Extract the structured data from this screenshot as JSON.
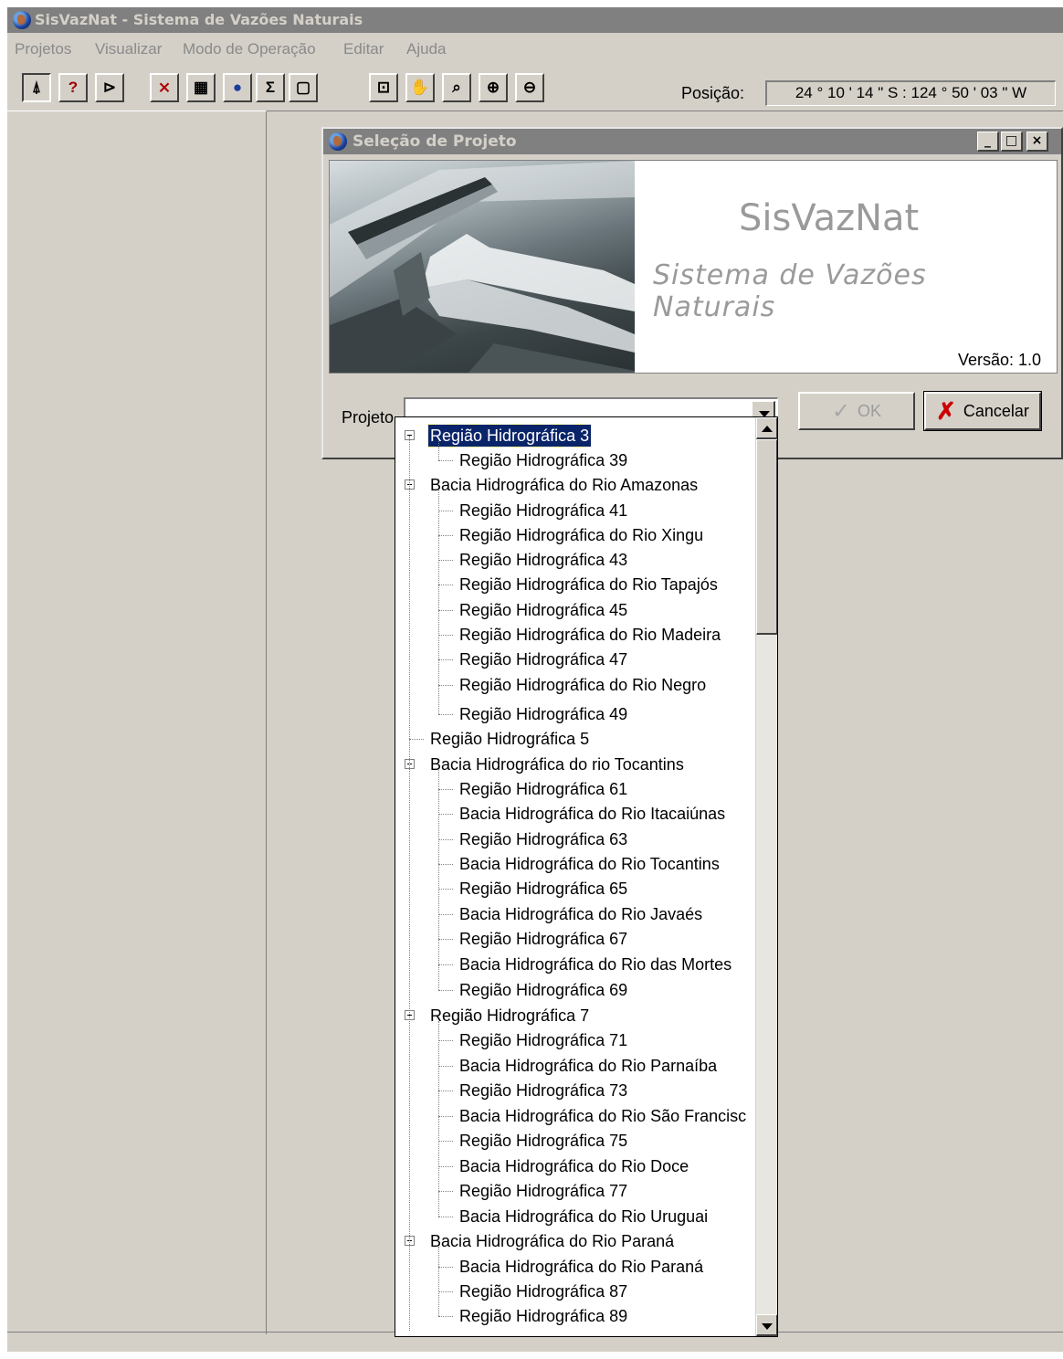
{
  "app": {
    "title": "SisVazNat - Sistema de Vazões Naturais"
  },
  "menu": [
    "Projetos",
    "Visualizar",
    "Modo de Operação",
    "Editar",
    "Ajuda"
  ],
  "toolbar": {
    "buttons": [
      {
        "name": "pointer-tool-icon",
        "glyph": "⍋"
      },
      {
        "name": "query-tool-icon",
        "glyph": "?"
      },
      {
        "name": "select-tool-icon",
        "glyph": "⊳"
      },
      {
        "name": "chart-icon",
        "glyph": "⨯"
      },
      {
        "name": "table-icon",
        "glyph": "▦"
      },
      {
        "name": "globe-icon",
        "glyph": "●"
      },
      {
        "name": "sum-icon",
        "glyph": "Σ"
      },
      {
        "name": "new-document-icon",
        "glyph": "▢"
      },
      {
        "name": "zoom-extent-icon",
        "glyph": "⊡"
      },
      {
        "name": "pan-hand-icon",
        "glyph": "✋"
      },
      {
        "name": "zoom-window-icon",
        "glyph": "⌕"
      },
      {
        "name": "zoom-in-icon",
        "glyph": "⊕"
      },
      {
        "name": "zoom-out-icon",
        "glyph": "⊖"
      }
    ],
    "position_label": "Posição:",
    "position_value": "24 ° 10 ' 14 \" S : 124 ° 50 ' 03 \" W"
  },
  "dialog": {
    "title": "Seleção de Projeto",
    "window_buttons": [
      "_",
      "□",
      "×"
    ],
    "brand": "SisVazNat",
    "brand_subtitle": "Sistema de Vazões Naturais",
    "version": "Versão: 1.0",
    "project_label": "Projeto",
    "project_value": "",
    "ok_label": "OK",
    "cancel_label": "Cancelar"
  },
  "tree": [
    {
      "label": "Região Hidrográfica 3",
      "level": 0,
      "expanded": true,
      "selected": true
    },
    {
      "label": "Região Hidrográfica 39",
      "level": 1
    },
    {
      "label": "Bacia Hidrográfica do Rio Amazonas",
      "level": 0,
      "expanded": true
    },
    {
      "label": "Região Hidrográfica 41",
      "level": 1
    },
    {
      "label": "Região Hidrográfica do Rio Xingu",
      "level": 1
    },
    {
      "label": "Região Hidrográfica 43",
      "level": 1
    },
    {
      "label": "Região Hidrográfica do Rio Tapajós",
      "level": 1
    },
    {
      "label": "Região Hidrográfica 45",
      "level": 1
    },
    {
      "label": "Região Hidrográfica do Rio Madeira",
      "level": 1
    },
    {
      "label": "Região Hidrográfica 47",
      "level": 1
    },
    {
      "label": "Região Hidrográfica do Rio Negro",
      "level": 1
    },
    {
      "label": "Região Hidrográfica 49",
      "level": 1
    },
    {
      "label": "Região Hidrográfica 5",
      "level": 0
    },
    {
      "label": "Bacia Hidrográfica do rio Tocantins",
      "level": 0,
      "expanded": true
    },
    {
      "label": "Região Hidrográfica 61",
      "level": 1
    },
    {
      "label": "Bacia Hidrográfica do Rio Itacaiúnas",
      "level": 1
    },
    {
      "label": "Região Hidrográfica 63",
      "level": 1
    },
    {
      "label": "Bacia Hidrográfica do Rio Tocantins",
      "level": 1
    },
    {
      "label": "Região Hidrográfica 65",
      "level": 1
    },
    {
      "label": "Bacia Hidrográfica do Rio Javaés",
      "level": 1
    },
    {
      "label": "Região Hidrográfica 67",
      "level": 1
    },
    {
      "label": "Bacia Hidrográfica do Rio das Mortes",
      "level": 1
    },
    {
      "label": "Região Hidrográfica 69",
      "level": 1
    },
    {
      "label": "Região Hidrográfica 7",
      "level": 0,
      "expanded": true
    },
    {
      "label": "Região Hidrográfica 71",
      "level": 1
    },
    {
      "label": "Bacia Hidrográfica do Rio Parnaíba",
      "level": 1
    },
    {
      "label": "Região Hidrográfica 73",
      "level": 1
    },
    {
      "label": "Bacia Hidrográfica do Rio São Francisc",
      "level": 1
    },
    {
      "label": "Região Hidrográfica 75",
      "level": 1
    },
    {
      "label": "Bacia Hidrográfica do Rio Doce",
      "level": 1
    },
    {
      "label": "Região Hidrográfica 77",
      "level": 1
    },
    {
      "label": "Bacia Hidrográfica do Rio Uruguai",
      "level": 1
    },
    {
      "label": "Bacia Hidrográfica do Rio Paraná",
      "level": 0,
      "expanded": true
    },
    {
      "label": "Bacia Hidrográfica do Rio Paraná",
      "level": 1
    },
    {
      "label": "Região Hidrográfica 87",
      "level": 1
    },
    {
      "label": "Região Hidrográfica 89",
      "level": 1
    }
  ]
}
